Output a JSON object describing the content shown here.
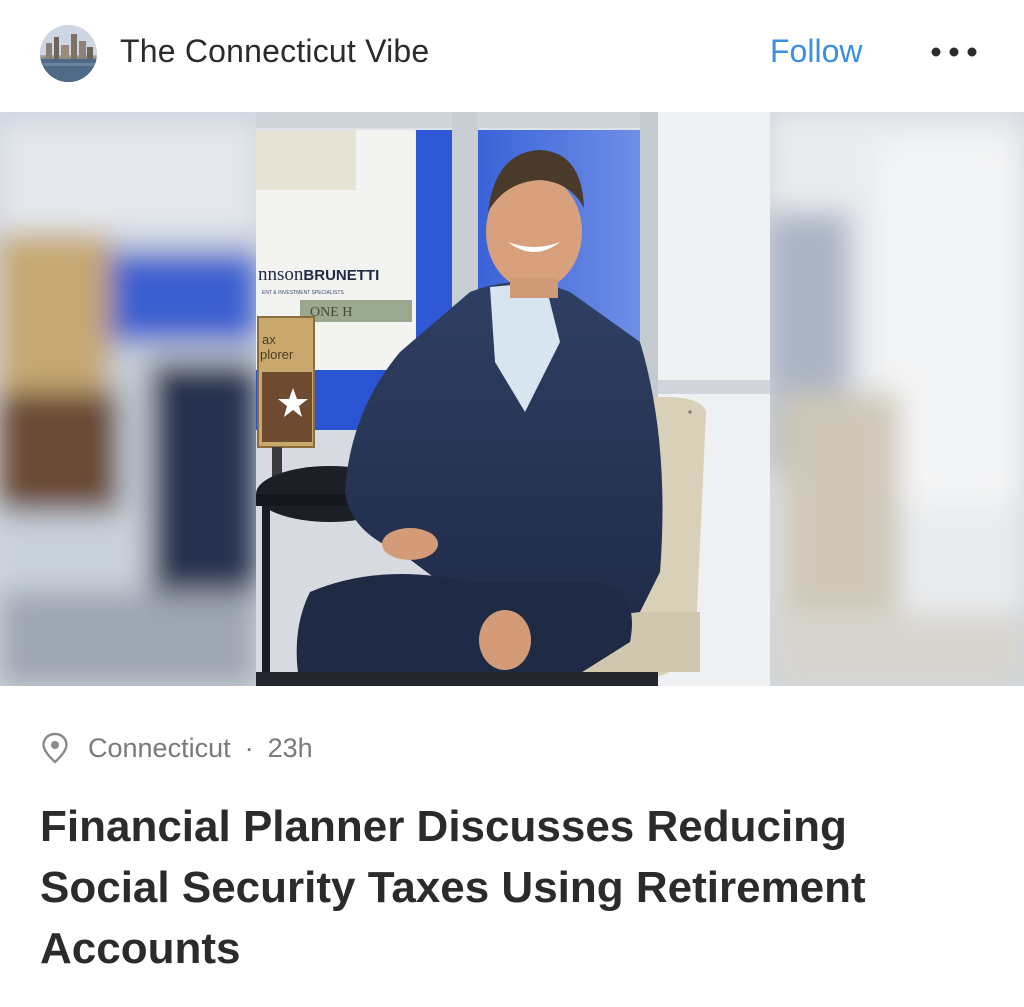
{
  "post": {
    "source_name": "The Connecticut Vibe",
    "follow_label": "Follow",
    "more_icon": "more-horizontal-icon",
    "location": "Connecticut",
    "separator": "·",
    "time_ago": "23h",
    "location_icon": "location-pin-icon",
    "headline": "Financial Planner Discusses Reducing Social Security Taxes Using Retirement Accounts"
  },
  "image": {
    "sign_text": "nnsonBRUNETTI",
    "sign_subtext": "ENT & INVESTMENT SPECIALISTS",
    "book_text": "ax\nplorer"
  },
  "colors": {
    "follow": "#3b8fe0",
    "text": "#2b2b2b",
    "meta": "#7a7a7a"
  }
}
